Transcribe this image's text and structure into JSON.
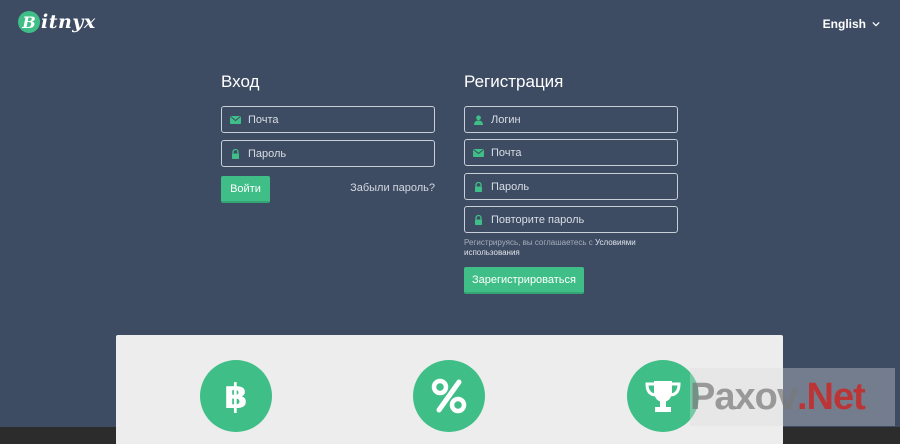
{
  "header": {
    "logo_letter": "B",
    "logo_text": "itnyx",
    "language": "English"
  },
  "login": {
    "title": "Вход",
    "email_placeholder": "Почта",
    "password_placeholder": "Пароль",
    "submit_label": "Войти",
    "forgot_label": "Забыли пароль?"
  },
  "register": {
    "title": "Регистрация",
    "login_placeholder": "Логин",
    "email_placeholder": "Почта",
    "password_placeholder": "Пароль",
    "repeat_password_placeholder": "Повторите пароль",
    "terms_prefix": "Регистрируясь, вы соглашаетесь с ",
    "terms_link": "Условиями использования",
    "submit_label": "Зарегистрироваться"
  },
  "features": {
    "icons": [
      "bitcoin-icon",
      "percent-icon",
      "trophy-icon"
    ]
  },
  "watermark": {
    "part1": "Paxov",
    "part2": ".Net"
  },
  "colors": {
    "background": "#3d4b63",
    "accent": "#3fbf87",
    "panel": "#ededed"
  }
}
